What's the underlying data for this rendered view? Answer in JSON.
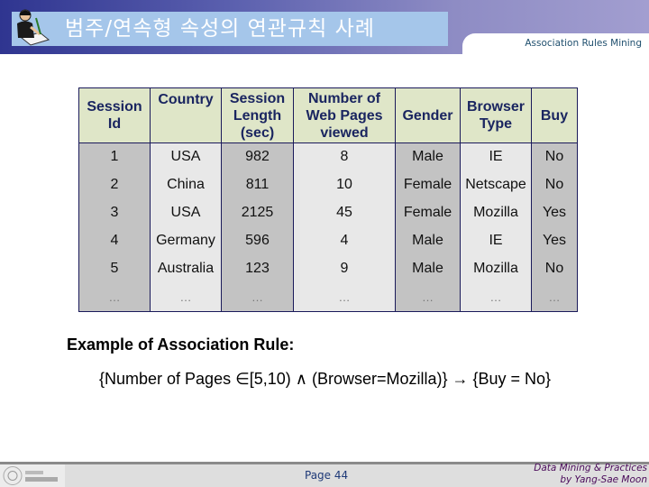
{
  "header": {
    "title": "범주/연속형 속성의 연관규칙 사례",
    "subtitle": "Association Rules Mining",
    "icon": "presenter-writing-icon"
  },
  "table": {
    "columns": [
      "Session Id",
      "Country",
      "Session Length (sec)",
      "Number of Web Pages viewed",
      "Gender",
      "Browser Type",
      "Buy"
    ],
    "header_lines": [
      [
        "Session",
        "Id"
      ],
      [
        "Country"
      ],
      [
        "Session",
        "Length",
        "(sec)"
      ],
      [
        "Number of",
        "Web Pages",
        "viewed"
      ],
      [
        "Gender"
      ],
      [
        "Browser",
        "Type"
      ],
      [
        "Buy"
      ]
    ],
    "rows": [
      [
        "1",
        "USA",
        "982",
        "8",
        "Male",
        "IE",
        "No"
      ],
      [
        "2",
        "China",
        "811",
        "10",
        "Female",
        "Netscape",
        "No"
      ],
      [
        "3",
        "USA",
        "2125",
        "45",
        "Female",
        "Mozilla",
        "Yes"
      ],
      [
        "4",
        "Germany",
        "596",
        "4",
        "Male",
        "IE",
        "Yes"
      ],
      [
        "5",
        "Australia",
        "123",
        "9",
        "Male",
        "Mozilla",
        "No"
      ],
      [
        "…",
        "…",
        "…",
        "…",
        "…",
        "…",
        "…"
      ]
    ]
  },
  "rule": {
    "heading": "Example of Association Rule:",
    "body": "{Number of Pages ∈[5,10) ∧ (Browser=Mozilla)} → {Buy = No}"
  },
  "footer": {
    "page": "Page 44",
    "credit_line1": "Data Mining & Practices",
    "credit_line2": "by Yang-Sae Moon",
    "logo": "university-logo"
  }
}
